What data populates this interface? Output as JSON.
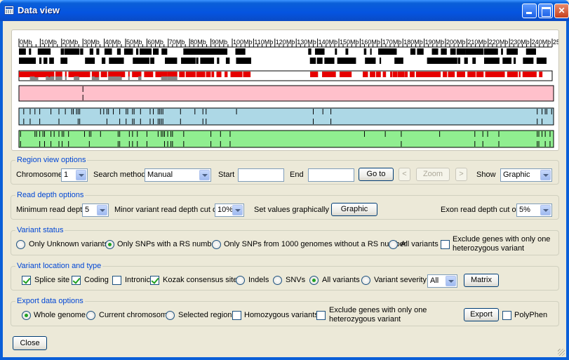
{
  "window": {
    "title": "Data view"
  },
  "genome_view": {
    "ruler_labels": [
      "0Mb",
      "10Mb",
      "20Mb",
      "30Mb",
      "40Mb",
      "50Mb",
      "60Mb",
      "70Mb",
      "80Mb",
      "90Mb",
      "100Mb",
      "110Mb",
      "120Mb",
      "130Mb",
      "140Mb",
      "150Mb",
      "160Mb",
      "170Mb",
      "180Mb",
      "190Mb",
      "200Mb",
      "210Mb",
      "220Mb",
      "230Mb",
      "240Mb",
      "250Mb"
    ],
    "track_colors": {
      "exon": "#e60000",
      "homozygous": "#ffc0cb",
      "heterozygous": "#add8e6",
      "variant": "#90ee90",
      "gene": "#000000"
    }
  },
  "region_view": {
    "title": "Region view options",
    "chromosome_label": "Chromosome",
    "chromosome_value": "1",
    "search_method_label": "Search method",
    "search_method_value": "Manual",
    "start_label": "Start",
    "end_label": "End",
    "goto_label": "Go to",
    "prev_label": "<",
    "zoom_label": "Zoom",
    "next_label": ">",
    "show_label": "Show",
    "show_value": "Graphic"
  },
  "read_depth": {
    "title": "Read depth options",
    "min_label": "Minimum read depth",
    "min_value": "5",
    "minor_label": "Minor variant read depth cut off",
    "minor_value": "10%",
    "set_label": "Set values graphically",
    "graphic_button": "Graphic",
    "exon_label": "Exon read depth cut off",
    "exon_value": "5%"
  },
  "variant_status": {
    "title": "Variant status",
    "opt_unknown": "Only Unknown variants",
    "opt_rs": "Only SNPs with a RS number",
    "opt_1000g": "Only SNPs from 1000 genomes without a RS number",
    "opt_all": "All variants",
    "exclude_line1": "Exclude genes with only one",
    "exclude_line2": "heterozygous variant"
  },
  "variant_location": {
    "title": "Variant location and type",
    "splice": "Splice site",
    "coding": "Coding",
    "intronic": "Intronic",
    "kozak": "Kozak consensus site",
    "indels": "Indels",
    "snvs": "SNVs",
    "all_variants": "All variants",
    "severity": "Variant severity",
    "severity_value": "All",
    "matrix_button": "Matrix"
  },
  "export": {
    "title": "Export data options",
    "whole": "Whole genome",
    "current": "Current chromosome",
    "selected": "Selected region",
    "homozygous": "Homozygous variants",
    "exclude_line1": "Exclude genes with only one",
    "exclude_line2": "heterozygous variant",
    "export_button": "Export",
    "polyphen": "PolyPhen"
  },
  "footer": {
    "close_button": "Close"
  }
}
